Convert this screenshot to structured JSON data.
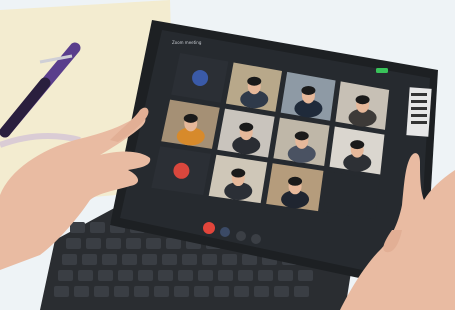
{
  "scene": {
    "description_tag": "",
    "screen_header_text": "Zoom meeting",
    "grid_cols": 4,
    "grid_rows": 3
  },
  "colors": {
    "background": "#eef3f6",
    "notebook_page": "#f3ecd0",
    "tablet_bezel": "#1d2023",
    "tablet_screen": "#262a2f",
    "keyboard": "#2a2d31",
    "skin": "#e9bba2",
    "end_call": "#e2453b",
    "avatar_blue": "#3a5aa8",
    "avatar_red": "#d9473d",
    "battery_green": "#39c35a",
    "pen_purple": "#5a3e8c"
  },
  "participants": [
    {
      "type": "avatar",
      "color": "avatar_blue"
    },
    {
      "type": "video",
      "shirt": "#2f3a4a",
      "room": "#b8a88a"
    },
    {
      "type": "video",
      "shirt": "#1f2a3a",
      "room": "#8e9aa5"
    },
    {
      "type": "video",
      "shirt": "#3d3a38",
      "room": "#c7c0b5"
    },
    {
      "type": "video",
      "shirt": "#d78a2b",
      "room": "#a59075"
    },
    {
      "type": "video",
      "shirt": "#2a2d33",
      "room": "#c9c4bd"
    },
    {
      "type": "video",
      "shirt": "#4a5262",
      "room": "#bfb7a8"
    },
    {
      "type": "video",
      "shirt": "#2d3035",
      "room": "#dad6cf"
    },
    {
      "type": "avatar",
      "color": "avatar_red"
    },
    {
      "type": "video",
      "shirt": "#2b2f36",
      "room": "#cfc7b8"
    },
    {
      "type": "video",
      "shirt": "#1f2530",
      "room": "#b59c7c"
    },
    {
      "type": "empty"
    }
  ],
  "controls": [
    "end-call",
    "mic",
    "camera",
    "more"
  ]
}
